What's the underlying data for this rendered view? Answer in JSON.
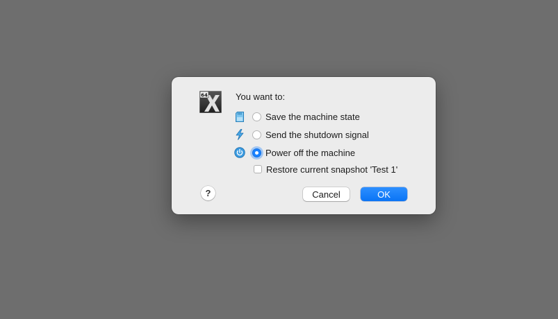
{
  "dialog": {
    "prompt": "You want to:",
    "app_icon": {
      "name": "virtualbox-vm-x64-icon",
      "badge": "64"
    },
    "options": [
      {
        "label": "Save the machine state",
        "icon": "sd-card-icon",
        "selected": false
      },
      {
        "label": "Send the shutdown signal",
        "icon": "lightning-icon",
        "selected": false
      },
      {
        "label": "Power off the machine",
        "icon": "power-icon",
        "selected": true
      }
    ],
    "restore_snapshot": {
      "label": "Restore current snapshot 'Test 1'",
      "checked": false
    },
    "help_label": "?",
    "cancel_label": "Cancel",
    "ok_label": "OK"
  },
  "colors": {
    "accent": "#1a82ff",
    "background": "#6e6e6e",
    "dialog_bg": "#ececec"
  }
}
